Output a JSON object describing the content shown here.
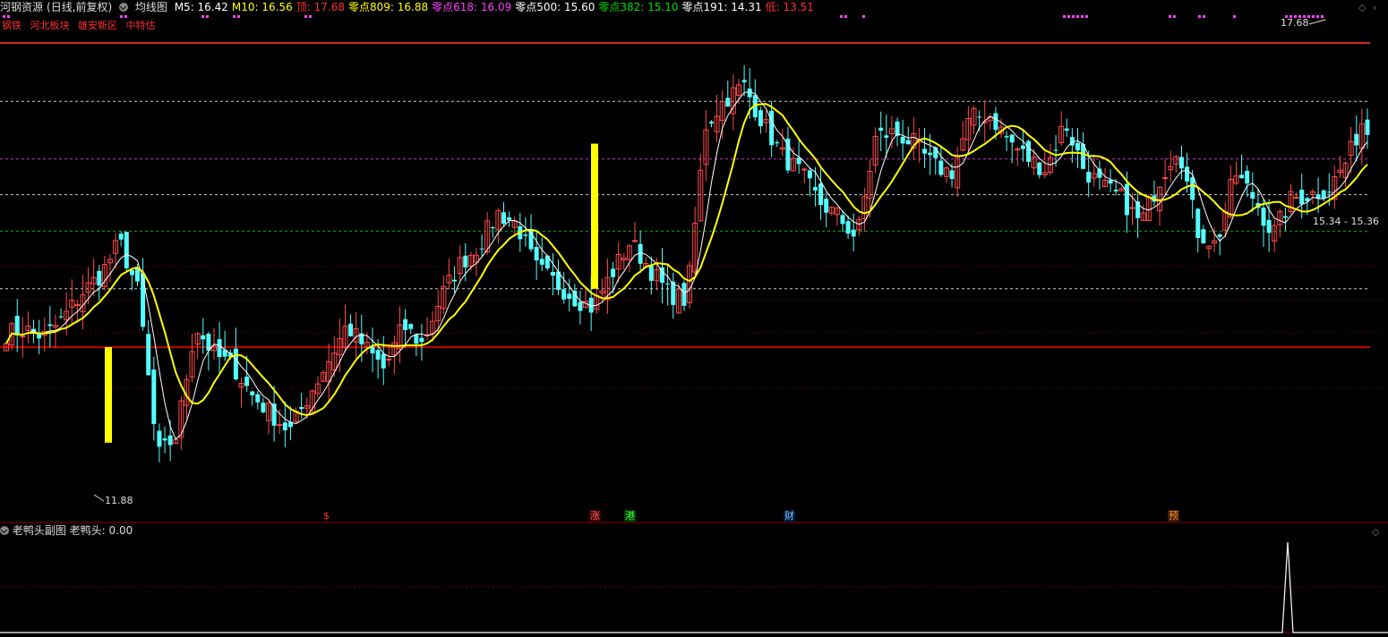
{
  "header": {
    "stock_name": "河钢资源",
    "mode": "(日线,前复权)",
    "chart_name": "均线图",
    "indicators": [
      {
        "label": "M5: 16.42",
        "color": "#ffffff"
      },
      {
        "label": "M10: 16.56",
        "color": "#ffff00"
      },
      {
        "label": "顶: 17.68",
        "color": "#ff3030"
      },
      {
        "label": "零点809: 16.88",
        "color": "#ffff00"
      },
      {
        "label": "零点618: 16.09",
        "color": "#ff40ff"
      },
      {
        "label": "零点500: 15.60",
        "color": "#ffffff"
      },
      {
        "label": "零点382: 15.10",
        "color": "#00e000"
      },
      {
        "label": "零点191: 14.31",
        "color": "#ffffff"
      },
      {
        "label": "低: 13.51",
        "color": "#ff3030"
      }
    ]
  },
  "tags": [
    "钢铁",
    "河北板块",
    "雄安新区",
    "中特估"
  ],
  "annotations": {
    "high_label": "17.68",
    "low_label": "11.88",
    "range_label": "15.34 - 15.36"
  },
  "event_markers": [
    {
      "text": "$",
      "color": "#ff3030",
      "bg": "#000000"
    },
    {
      "text": "涨",
      "color": "#ff6060",
      "bg": "#3a0000"
    },
    {
      "text": "港",
      "color": "#40ff40",
      "bg": "#003a00"
    },
    {
      "text": "财",
      "color": "#80c0ff",
      "bg": "#001a3a"
    },
    {
      "text": "预",
      "color": "#ff9040",
      "bg": "#3a1a00"
    }
  ],
  "sub_chart": {
    "title": "老鸭头副图",
    "value_label": "老鸭头: 0.00"
  },
  "colors": {
    "up": "#ff4a4a",
    "down": "#54ffff",
    "ma5": "#ffffff",
    "ma10": "#ffff00",
    "level_line": "#ff0000",
    "background": "#000000"
  },
  "chart_data": {
    "type": "candlestick",
    "y_range": [
      11.4,
      18.0
    ],
    "level_lines": [
      {
        "name": "顶",
        "value": 17.68,
        "color": "#ff3030",
        "style": "solid"
      },
      {
        "name": "零点809",
        "value": 16.88,
        "color": "#ffffff",
        "style": "dashed"
      },
      {
        "name": "零点618",
        "value": 16.09,
        "color": "#ff40ff",
        "style": "dashed"
      },
      {
        "name": "零点500",
        "value": 15.6,
        "color": "#ffffff",
        "style": "dashed"
      },
      {
        "name": "零点382",
        "value": 15.1,
        "color": "#00e000",
        "style": "dashed"
      },
      {
        "name": "零点191",
        "value": 14.31,
        "color": "#ffffff",
        "style": "dashed"
      },
      {
        "name": "低",
        "value": 13.51,
        "color": "#ff0000",
        "style": "solid"
      }
    ],
    "close_path": [
      13.7,
      13.75,
      13.65,
      13.9,
      14.25,
      14.5,
      14.95,
      14.25,
      12.0,
      12.3,
      13.8,
      13.4,
      13.25,
      12.85,
      12.6,
      12.35,
      12.85,
      13.3,
      13.8,
      13.5,
      13.2,
      13.8,
      13.55,
      14.2,
      14.65,
      14.9,
      15.35,
      15.2,
      14.6,
      14.4,
      14.2,
      14.05,
      14.5,
      14.95,
      14.6,
      14.25,
      14.15,
      16.55,
      16.9,
      17.1,
      16.6,
      16.15,
      15.9,
      15.5,
      15.3,
      15.0,
      16.4,
      16.45,
      16.3,
      16.0,
      15.9,
      16.65,
      16.7,
      16.35,
      16.1,
      15.95,
      16.6,
      15.95,
      15.7,
      15.55,
      15.2,
      15.8,
      16.3,
      15.1,
      14.9,
      15.9,
      15.55,
      15.05,
      15.55,
      15.6,
      15.7,
      16.1,
      16.8
    ],
    "sub_series": {
      "type": "line",
      "peak_value": 1,
      "peak_position": "right end",
      "current_value": 0.0
    }
  }
}
